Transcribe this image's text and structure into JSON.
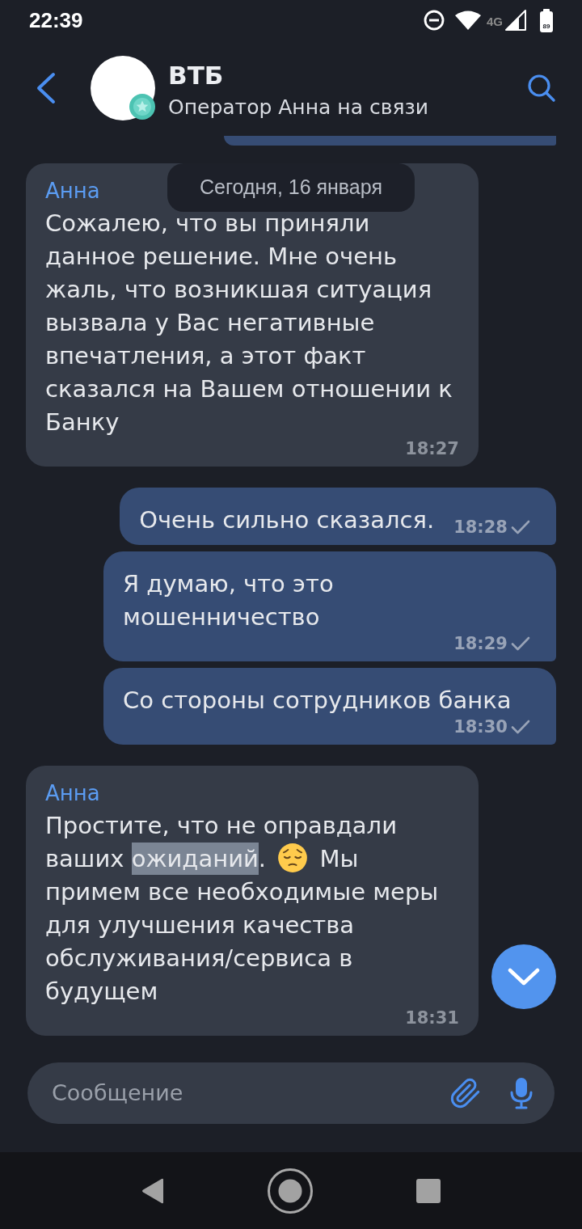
{
  "status_bar": {
    "time": "22:39",
    "network": "4G",
    "battery": "89"
  },
  "header": {
    "title": "ВТБ",
    "subtitle": "Оператор Анна на связи"
  },
  "date_label": "Сегодня, 16 января",
  "messages": [
    {
      "kind": "incoming",
      "sender": "Анна",
      "text": "Сожалею, что вы приняли данное решение. Мне очень жаль, что возникшая ситуация вызвала у Вас негативные впечатления, а этот факт сказался на Вашем отношении к Банку",
      "time": "18:27"
    },
    {
      "kind": "outgoing",
      "text": "Очень сильно сказался.",
      "time": "18:28",
      "sent": true
    },
    {
      "kind": "outgoing",
      "text": "Я думаю, что это мошенничество",
      "time": "18:29",
      "sent": true
    },
    {
      "kind": "outgoing",
      "text": "Со стороны сотрудников банка",
      "time": "18:30",
      "sent": true
    },
    {
      "kind": "incoming",
      "sender": "Анна",
      "parts": [
        {
          "kind": "text",
          "text": "Простите, что не оправдали ваших ",
          "selected": false
        },
        {
          "kind": "text",
          "text": "ожиданий",
          "selected": true
        },
        {
          "kind": "text",
          "text": ". ",
          "selected": false
        },
        {
          "kind": "emoji",
          "selected": false
        },
        {
          "kind": "text",
          "text": " Мы примем все необходимые меры для улучшения качества обслуживания/сервиса в будущем",
          "selected": false
        }
      ],
      "time": "18:31"
    }
  ],
  "composer": {
    "placeholder": "Сообщение"
  }
}
